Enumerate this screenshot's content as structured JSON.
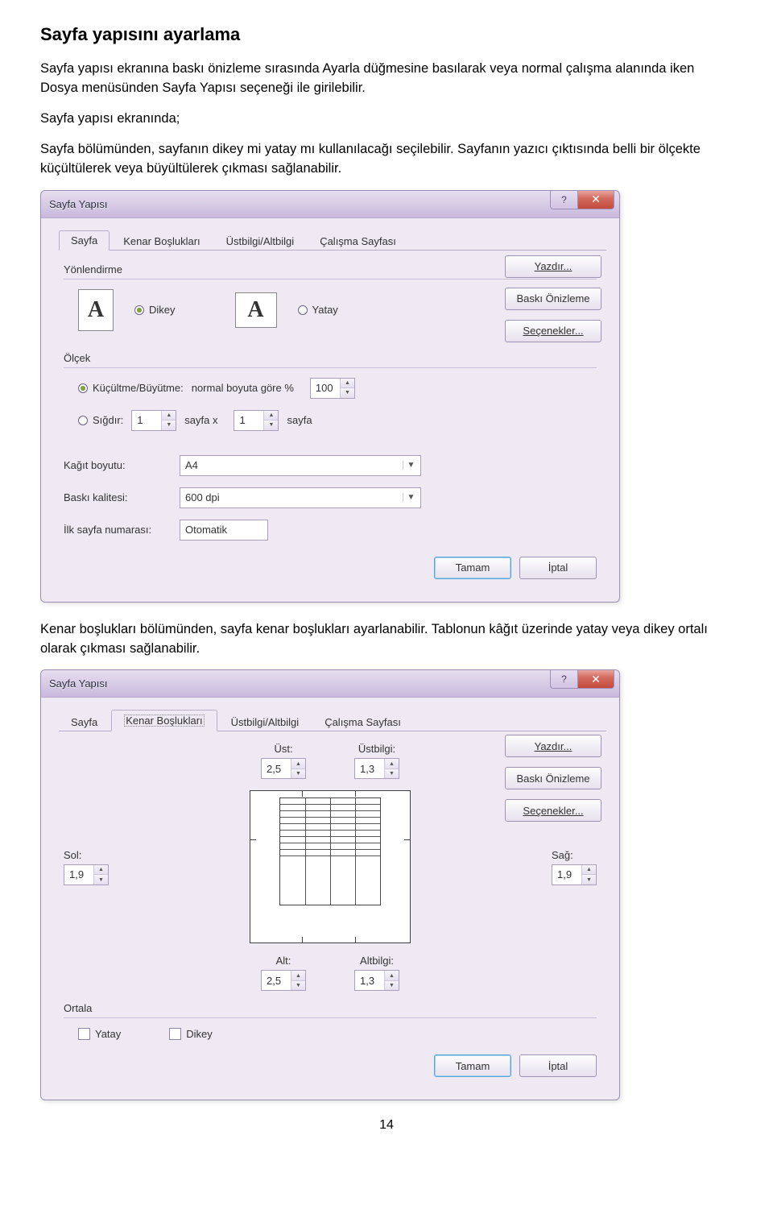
{
  "heading": "Sayfa yapısını ayarlama",
  "para1": "Sayfa yapısı ekranına baskı önizleme sırasında Ayarla düğmesine basılarak veya normal çalışma alanında iken Dosya menüsünden Sayfa Yapısı seçeneği ile girilebilir.",
  "para2": "Sayfa yapısı ekranında;",
  "para3": "Sayfa bölümünden, sayfanın dikey mi yatay mı kullanılacağı seçilebilir. Sayfanın yazıcı çıktısında belli bir ölçekte küçültülerek veya büyültülerek çıkması sağlanabilir.",
  "para4": "Kenar boşlukları bölümünden, sayfa kenar boşlukları ayarlanabilir. Tablonun kâğıt üzerinde yatay veya dikey ortalı olarak çıkması sağlanabilir.",
  "page_number": "14",
  "dialog": {
    "title": "Sayfa Yapısı",
    "tabs": [
      "Sayfa",
      "Kenar Boşlukları",
      "Üstbilgi/Altbilgi",
      "Çalışma Sayfası"
    ],
    "side_buttons": {
      "print": "Yazdır...",
      "preview": "Baskı Önizleme",
      "options": "Seçenekler..."
    },
    "footer": {
      "ok": "Tamam",
      "cancel": "İptal"
    }
  },
  "dialog1": {
    "group_orientation": "Yönlendirme",
    "opt_portrait": "Dikey",
    "opt_landscape": "Yatay",
    "group_scale": "Ölçek",
    "opt_zoom": "Küçültme/Büyütme:",
    "zoom_desc": "normal boyuta göre %",
    "zoom_value": "100",
    "opt_fit": "Sığdır:",
    "fit_w": "1",
    "fit_mid": "sayfa  x",
    "fit_h": "1",
    "fit_tail": "sayfa",
    "paper_label": "Kağıt boyutu:",
    "paper_value": "A4",
    "quality_label": "Baskı kalitesi:",
    "quality_value": "600 dpi",
    "firstpage_label": "İlk sayfa numarası:",
    "firstpage_value": "Otomatik"
  },
  "dialog2": {
    "top_label": "Üst:",
    "top_value": "2,5",
    "header_label": "Üstbilgi:",
    "header_value": "1,3",
    "left_label": "Sol:",
    "left_value": "1,9",
    "right_label": "Sağ:",
    "right_value": "1,9",
    "bottom_label": "Alt:",
    "bottom_value": "2,5",
    "footer_label": "Altbilgi:",
    "footer_value": "1,3",
    "center_group": "Ortala",
    "center_h": "Yatay",
    "center_v": "Dikey"
  }
}
